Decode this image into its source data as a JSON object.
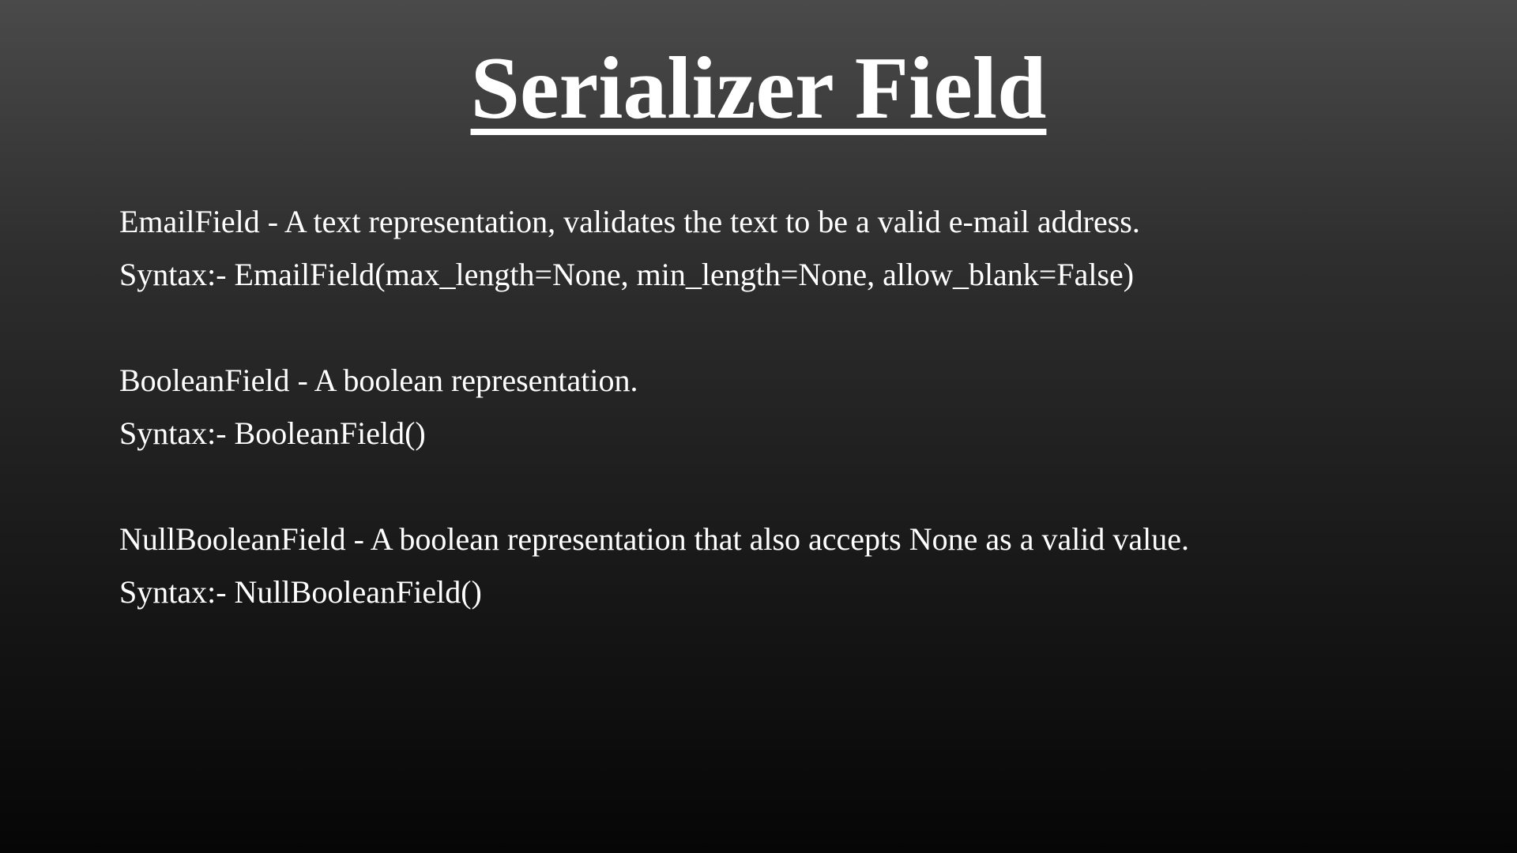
{
  "slide": {
    "title": "Serializer Field",
    "fields": [
      {
        "description": "EmailField - A text representation, validates the text to be a valid e-mail address.",
        "syntax": "Syntax:- EmailField(max_length=None, min_length=None, allow_blank=False)"
      },
      {
        "description": "BooleanField - A boolean representation.",
        "syntax": "Syntax:- BooleanField()"
      },
      {
        "description": "NullBooleanField - A boolean representation that also accepts None as a valid value.",
        "syntax": "Syntax:- NullBooleanField()"
      }
    ]
  },
  "colors": {
    "text": "#ffffff",
    "background_top": "#4a4a4a",
    "background_bottom": "#060606"
  }
}
